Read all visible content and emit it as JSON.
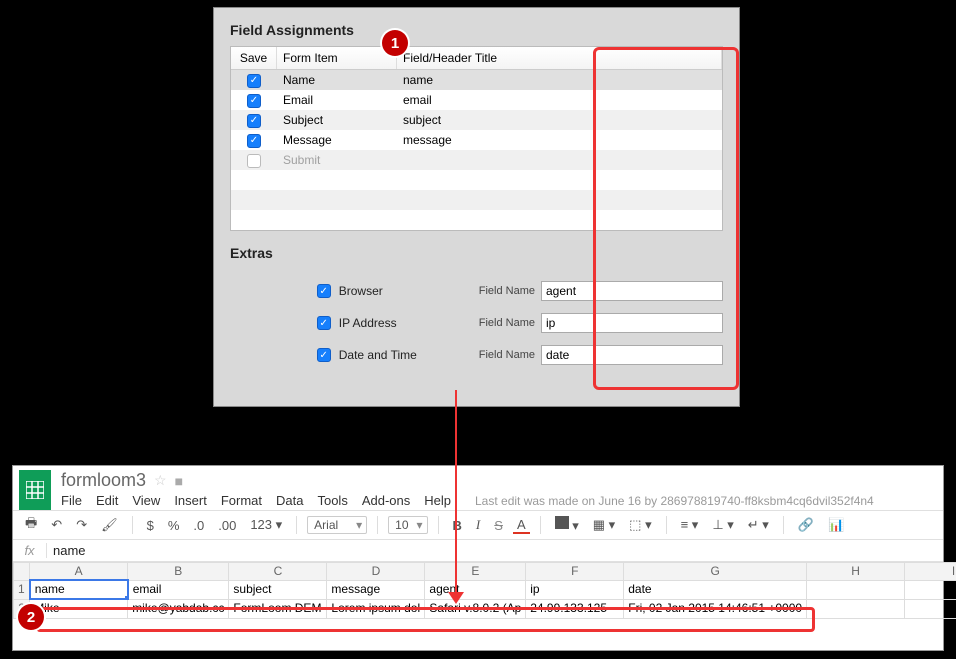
{
  "annotations": {
    "badge1": "1",
    "badge2": "2"
  },
  "form_panel": {
    "title_assignments": "Field Assignments",
    "title_extras": "Extras",
    "headers": {
      "save": "Save",
      "form_item": "Form Item",
      "field_title": "Field/Header Title"
    },
    "rows": [
      {
        "checked": true,
        "item": "Name",
        "field": "name"
      },
      {
        "checked": true,
        "item": "Email",
        "field": "email"
      },
      {
        "checked": true,
        "item": "Subject",
        "field": "subject"
      },
      {
        "checked": true,
        "item": "Message",
        "field": "message"
      },
      {
        "checked": false,
        "item": "Submit",
        "field": ""
      }
    ],
    "extras": {
      "field_name_label": "Field Name",
      "items": [
        {
          "label": "Browser",
          "value": "agent"
        },
        {
          "label": "IP Address",
          "value": "ip"
        },
        {
          "label": "Date and Time",
          "value": "date"
        }
      ]
    }
  },
  "sheets": {
    "doc_title": "formloom3",
    "last_edit": "Last edit was made on June 16 by 286978819740-ff8ksbm4cq6dvil352f4n4",
    "menus": {
      "file": "File",
      "edit": "Edit",
      "view": "View",
      "insert": "Insert",
      "format": "Format",
      "data": "Data",
      "tools": "Tools",
      "addons": "Add-ons",
      "help": "Help"
    },
    "toolbar": {
      "currency": "$",
      "percent": "%",
      "dec_less": ".0",
      "dec_more": ".00",
      "num_fmt": "123",
      "font": "Arial",
      "size": "10",
      "bold": "B",
      "italic": "I",
      "strike": "S",
      "text_color": "A"
    },
    "fx_value": "name",
    "col_letters": [
      "A",
      "B",
      "C",
      "D",
      "E",
      "F",
      "G",
      "H",
      "I"
    ],
    "row1": {
      "num": "1",
      "cells": [
        "name",
        "email",
        "subject",
        "message",
        "agent",
        "ip",
        "date",
        "",
        ""
      ]
    },
    "row2": {
      "num": "2",
      "cells": [
        "Mike",
        "mike@yabdab.cc",
        "FormLoom DEM",
        "Lorem ipsum dol",
        "Safari v.8.0.2 (Ap",
        "24.99.133.125",
        "Fri, 02 Jan 2015 14:46:51 +0000",
        "",
        ""
      ]
    }
  }
}
